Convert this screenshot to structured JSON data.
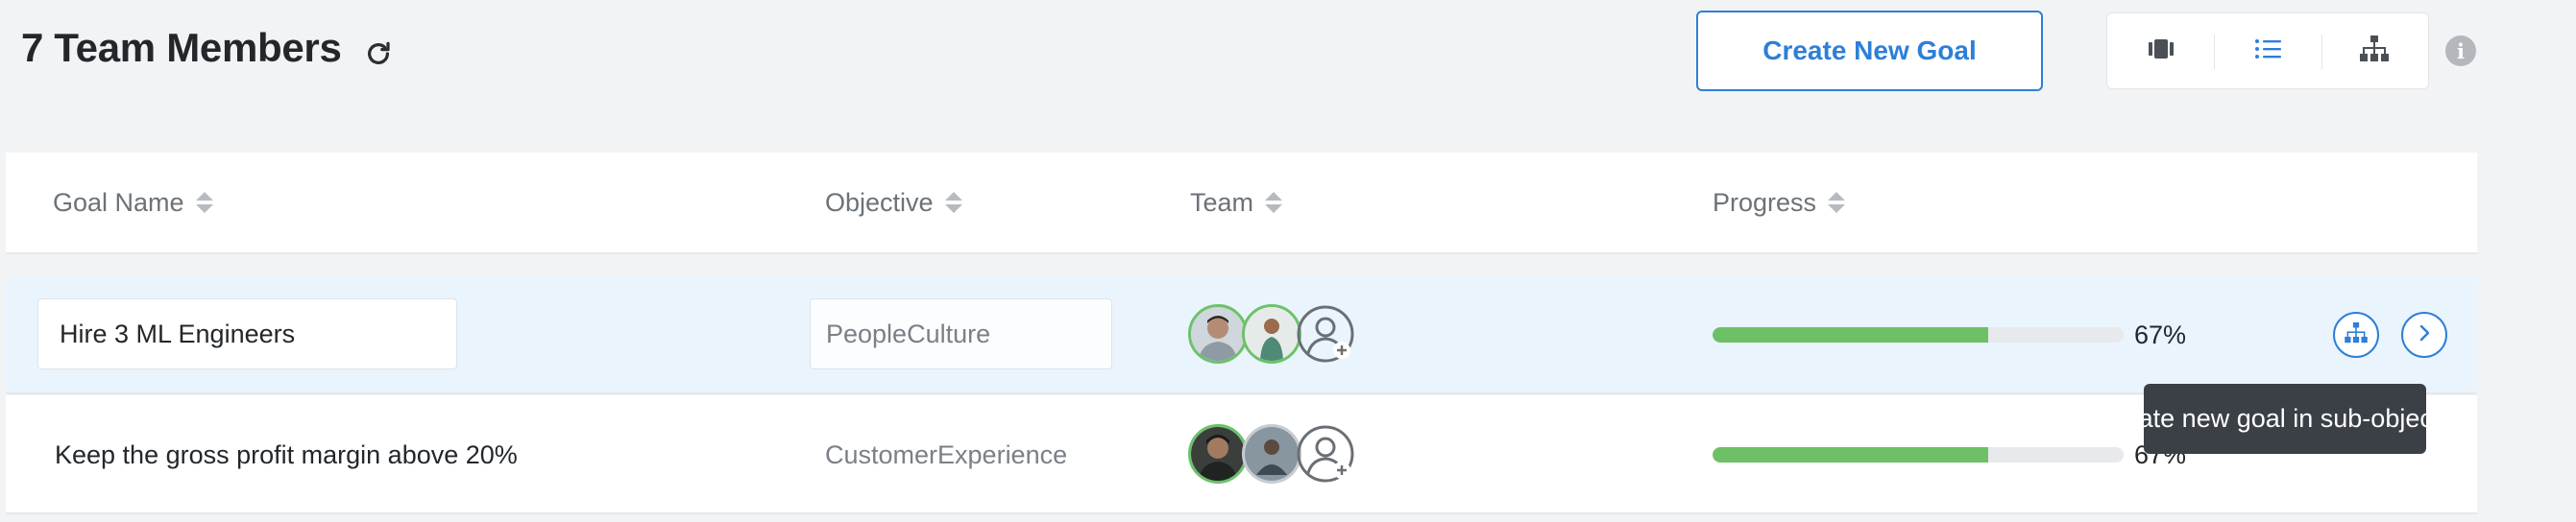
{
  "header": {
    "title": "7 Team Members",
    "create_button_label": "Create New Goal"
  },
  "view_switch": {
    "options": [
      "kanban-view",
      "list-view",
      "tree-view"
    ],
    "active": "list-view"
  },
  "table": {
    "columns": [
      "Goal Name",
      "Objective",
      "Team",
      "Progress"
    ],
    "rows": [
      {
        "goal": "Hire 3 ML Engineers",
        "objective": "PeopleCulture",
        "progress_percent": 67,
        "progress_label": "67%",
        "highlighted": true
      },
      {
        "goal": "Keep the gross profit margin above 20%",
        "objective": "CustomerExperience",
        "progress_percent": 67,
        "progress_label": "67%",
        "highlighted": false
      }
    ]
  },
  "tooltip": {
    "text": "Create new goal in sub-objective"
  },
  "colors": {
    "accent": "#2d7fd8",
    "progress": "#6ec066",
    "avatar_ring": "#6cc26a",
    "highlight_row": "#eaf4fd",
    "tooltip_bg": "#3b4046"
  }
}
